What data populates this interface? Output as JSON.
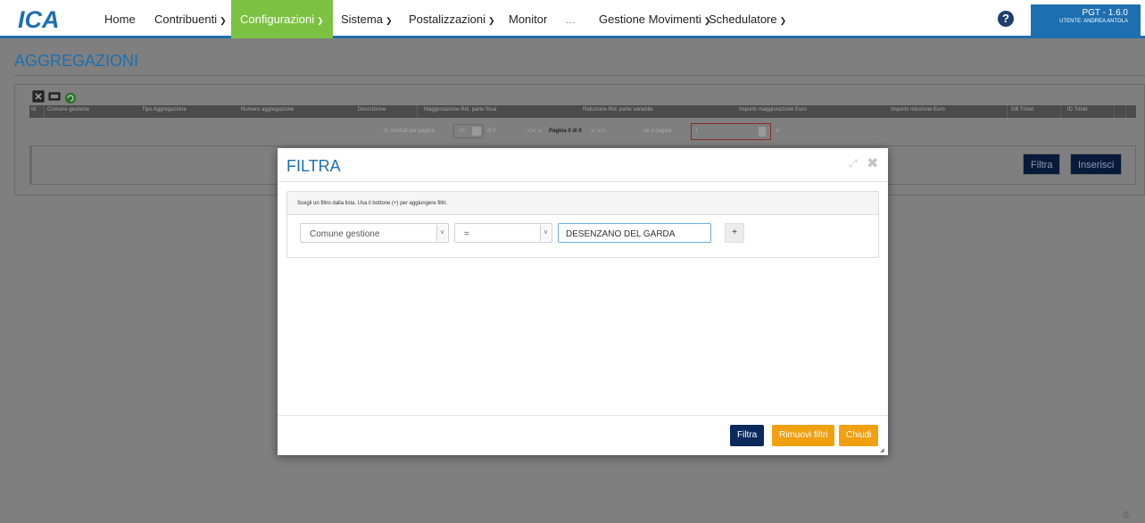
{
  "header": {
    "logo_text": "ICA",
    "nav": [
      {
        "label": "Home",
        "has_dropdown": false
      },
      {
        "label": "Contribuenti",
        "has_dropdown": true
      },
      {
        "label": "Configurazioni",
        "has_dropdown": true,
        "active": true
      },
      {
        "label": "Sistema",
        "has_dropdown": true
      },
      {
        "label": "Postalizzazioni",
        "has_dropdown": true
      },
      {
        "label": "Monitor",
        "has_dropdown": false
      },
      {
        "label": "...",
        "has_dropdown": false
      },
      {
        "label": "Gestione Movimenti",
        "has_dropdown": true
      },
      {
        "label": "Schedulatore",
        "has_dropdown": true
      }
    ],
    "help_icon": "question-circle-icon",
    "version": "PGT - 1.6.0",
    "user": "UTENTE: ANDREA ANTOLA"
  },
  "page": {
    "title": "AGGREGAZIONI",
    "toolbar_icons": [
      "excel-export-icon",
      "csv-export-icon",
      "refresh-icon"
    ],
    "grid": {
      "columns": [
        "Id",
        "Comune gestione",
        "Tipo Aggregazione",
        "Numero aggregazione",
        "Descrizione",
        "Maggiorazione-Rid. parte fissa",
        "Riduzione-Rid. parte variabile",
        "Importo maggiorazione Euro",
        "Importo riduzione Euro",
        "DB Trinet",
        "ID Trinet"
      ]
    },
    "pager": {
      "per_page_label": "N. risultati per pagina",
      "per_page_value": "10",
      "of_label": "di 0",
      "nav_first_prev": "<<  <",
      "page_info": "Pagina 0 di 0",
      "nav_next_last": ">  >>",
      "goto_label": "vai a pagina",
      "goto_value": "1",
      "goto_arrow": ">"
    },
    "buttons": {
      "filter": "Filtra",
      "insert": "Inserisci"
    }
  },
  "modal": {
    "title": "FILTRA",
    "hint": "Scegli un filtro dalla lista. Usa il bottone (+) per aggiungere filtri.",
    "field_select": "Comune gestione",
    "operator_select": "=",
    "value_input": "DESENZANO DEL GARDA",
    "add_button": "+",
    "footer": {
      "filter": "Filtra",
      "remove": "Rimuovi filtri",
      "close": "Chiudi"
    }
  },
  "colors": {
    "brand_blue": "#1d6fb0",
    "nav_active": "#7cc242",
    "primary_button": "#0b2a5c",
    "orange_button": "#f0a010"
  }
}
